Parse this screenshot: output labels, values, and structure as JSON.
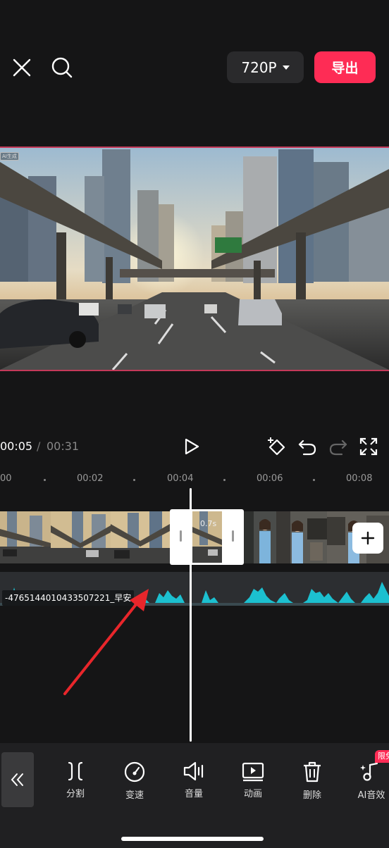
{
  "header": {
    "resolution_label": "720P",
    "export_label": "导出"
  },
  "preview": {
    "ai_tag": "AI生成"
  },
  "playback": {
    "current_time": "00:05",
    "separator": "/",
    "total_time": "00:31"
  },
  "ruler": {
    "labels": [
      "00",
      "00:02",
      "00:04",
      "00:06",
      "00:08"
    ]
  },
  "timeline": {
    "selected_clip_duration": "0.7s",
    "audio_clip_name": "-4765144010433507221_早安"
  },
  "toolbar": {
    "items": [
      {
        "label": "分割",
        "icon": "split-icon"
      },
      {
        "label": "变速",
        "icon": "speed-icon"
      },
      {
        "label": "音量",
        "icon": "volume-icon"
      },
      {
        "label": "动画",
        "icon": "animation-icon"
      },
      {
        "label": "删除",
        "icon": "delete-icon"
      },
      {
        "label": "AI音效",
        "icon": "ai-sound-icon"
      }
    ],
    "badge": "限免"
  },
  "colors": {
    "background": "#151516",
    "accent": "#fe2c55",
    "waveform": "#1cc0d0",
    "annotation_arrow": "#e8262b"
  }
}
